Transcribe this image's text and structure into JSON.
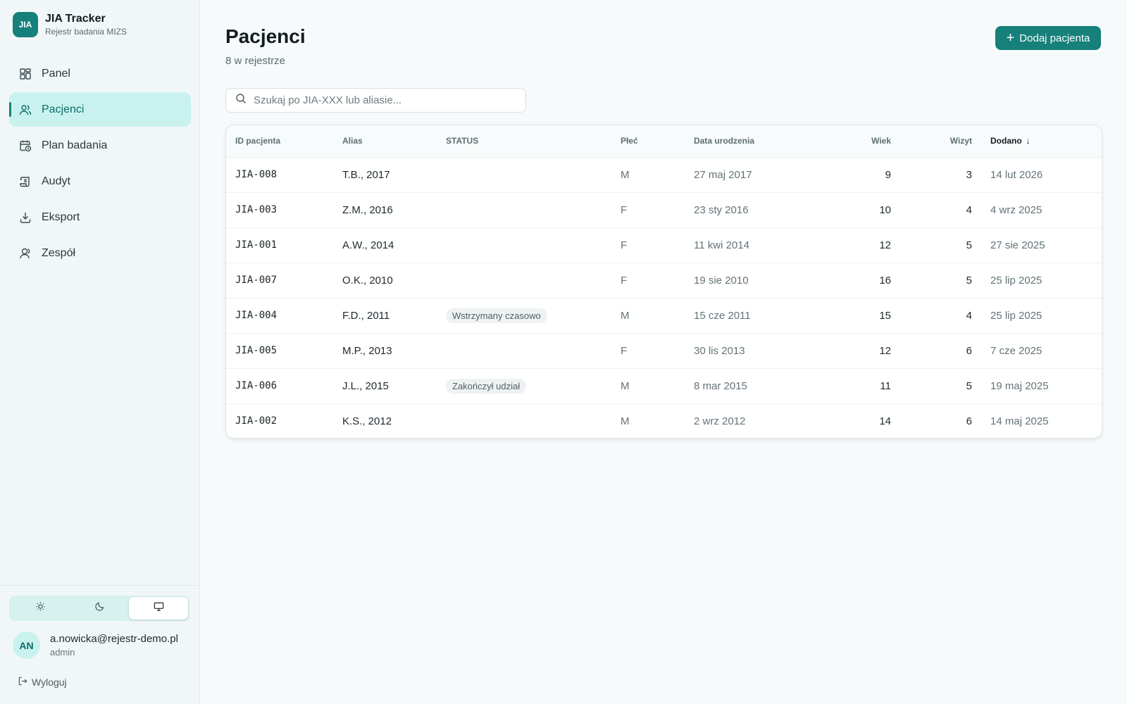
{
  "brand": {
    "logo": "JIA",
    "title": "JIA Tracker",
    "subtitle": "Rejestr badania MIZS"
  },
  "nav": [
    {
      "label": "Panel",
      "icon": "dashboard-icon",
      "active": false
    },
    {
      "label": "Pacjenci",
      "icon": "users-icon",
      "active": true
    },
    {
      "label": "Plan badania",
      "icon": "calendar-clock-icon",
      "active": false
    },
    {
      "label": "Audyt",
      "icon": "scroll-icon",
      "active": false
    },
    {
      "label": "Eksport",
      "icon": "download-icon",
      "active": false
    },
    {
      "label": "Zespół",
      "icon": "user-icon",
      "active": false
    }
  ],
  "theme": {
    "options": [
      "sun-icon",
      "moon-icon",
      "monitor-icon"
    ],
    "selected": "monitor-icon"
  },
  "user": {
    "initials": "AN",
    "email": "a.nowicka@rejestr-demo.pl",
    "role": "admin"
  },
  "logout_label": "Wyloguj",
  "page": {
    "title": "Pacjenci",
    "subtitle": "8 w rejestrze",
    "add_label": "Dodaj pacjenta"
  },
  "search": {
    "placeholder": "Szukaj po JIA-XXX lub aliasie...",
    "value": ""
  },
  "table": {
    "headers": {
      "id": "ID pacjenta",
      "alias": "Alias",
      "status": "STATUS",
      "sex": "Płeć",
      "dob": "Data urodzenia",
      "age": "Wiek",
      "visits": "Wizyt",
      "added": "Dodano"
    },
    "sort": {
      "column": "added",
      "direction": "desc",
      "arrow": "↓"
    },
    "rows": [
      {
        "id": "JIA-008",
        "alias": "T.B., 2017",
        "status": "",
        "sex": "M",
        "dob": "27 maj 2017",
        "age": "9",
        "visits": "3",
        "added": "14 lut 2026"
      },
      {
        "id": "JIA-003",
        "alias": "Z.M., 2016",
        "status": "",
        "sex": "F",
        "dob": "23 sty 2016",
        "age": "10",
        "visits": "4",
        "added": "4 wrz 2025"
      },
      {
        "id": "JIA-001",
        "alias": "A.W., 2014",
        "status": "",
        "sex": "F",
        "dob": "11 kwi 2014",
        "age": "12",
        "visits": "5",
        "added": "27 sie 2025"
      },
      {
        "id": "JIA-007",
        "alias": "O.K., 2010",
        "status": "",
        "sex": "F",
        "dob": "19 sie 2010",
        "age": "16",
        "visits": "5",
        "added": "25 lip 2025"
      },
      {
        "id": "JIA-004",
        "alias": "F.D., 2011",
        "status": "Wstrzymany czasowo",
        "sex": "M",
        "dob": "15 cze 2011",
        "age": "15",
        "visits": "4",
        "added": "25 lip 2025"
      },
      {
        "id": "JIA-005",
        "alias": "M.P., 2013",
        "status": "",
        "sex": "F",
        "dob": "30 lis 2013",
        "age": "12",
        "visits": "6",
        "added": "7 cze 2025"
      },
      {
        "id": "JIA-006",
        "alias": "J.L., 2015",
        "status": "Zakończył udział",
        "sex": "M",
        "dob": "8 mar 2015",
        "age": "11",
        "visits": "5",
        "added": "19 maj 2025"
      },
      {
        "id": "JIA-002",
        "alias": "K.S., 2012",
        "status": "",
        "sex": "M",
        "dob": "2 wrz 2012",
        "age": "14",
        "visits": "6",
        "added": "14 maj 2025"
      }
    ]
  },
  "colors": {
    "accent": "#16807a",
    "active_nav_bg": "#c9f2ee",
    "background": "#f6fafb"
  }
}
